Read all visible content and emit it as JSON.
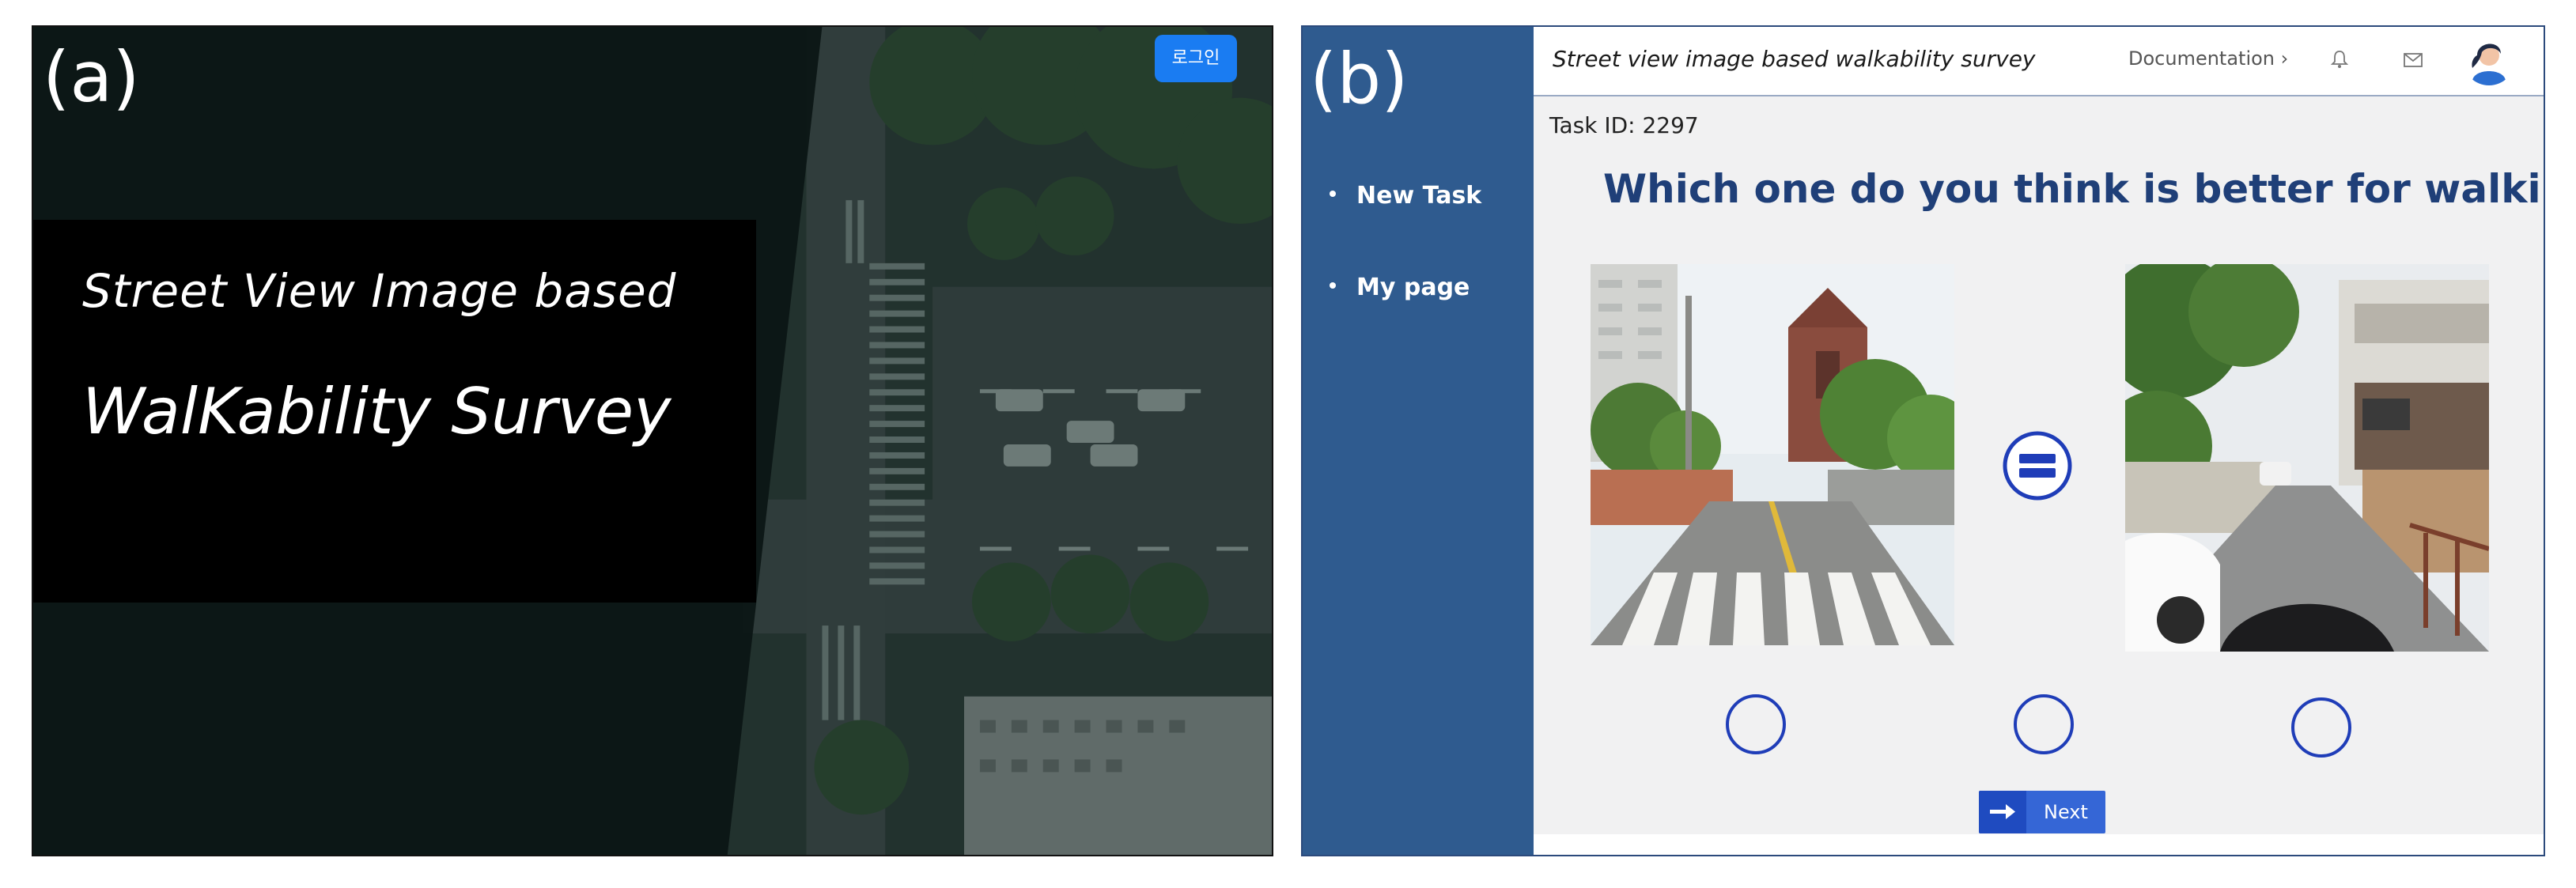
{
  "panel_a": {
    "label": "(a)",
    "subtitle": "Street View Image based",
    "title": "WalKability Survey",
    "login_button": "로그인"
  },
  "panel_b": {
    "label": "(b)",
    "app_title": "Street view image based walkability survey",
    "documentation_link": "Documentation ›",
    "nav": [
      {
        "label": "New Task"
      },
      {
        "label": "My page"
      }
    ],
    "task_id": "Task ID: 2297",
    "question": "Which one do you think is better for walking?",
    "next_button": "Next",
    "options": [
      "left-image",
      "equal",
      "right-image"
    ]
  },
  "colors": {
    "sidebar": "#2f5b8f",
    "question_text": "#1f3f78",
    "radio_border": "#1f3db8",
    "next_button": "#3566d6",
    "login_button": "#1a7cf2"
  },
  "icons": [
    "bell-icon",
    "mail-icon",
    "avatar",
    "equal-icon",
    "arrow-right-icon"
  ]
}
